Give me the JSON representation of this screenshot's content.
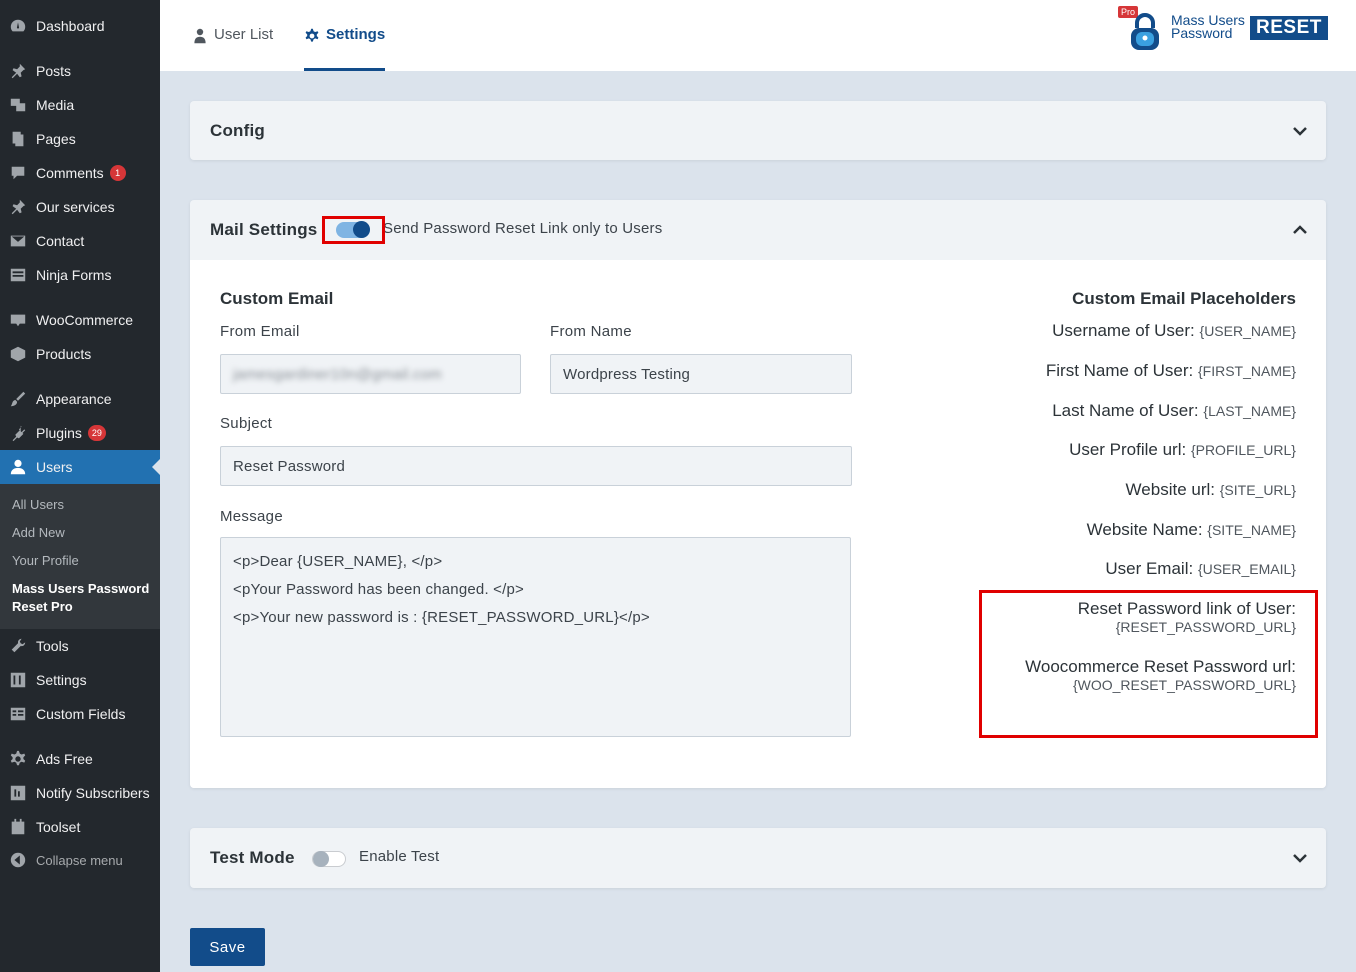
{
  "sidebar": {
    "items": [
      {
        "label": "Dashboard",
        "icon": "dashboard-icon"
      },
      {
        "label": "Posts",
        "icon": "pin-icon"
      },
      {
        "label": "Media",
        "icon": "media-icon"
      },
      {
        "label": "Pages",
        "icon": "pages-icon"
      },
      {
        "label": "Comments",
        "icon": "comment-icon",
        "badge": "1"
      },
      {
        "label": "Our services",
        "icon": "pin-icon"
      },
      {
        "label": "Contact",
        "icon": "mail-icon"
      },
      {
        "label": "Ninja Forms",
        "icon": "forms-icon"
      },
      {
        "label": "WooCommerce",
        "icon": "woo-icon"
      },
      {
        "label": "Products",
        "icon": "box-icon"
      },
      {
        "label": "Appearance",
        "icon": "brush-icon"
      },
      {
        "label": "Plugins",
        "icon": "plugin-icon",
        "badge": "29"
      },
      {
        "label": "Users",
        "icon": "user-icon"
      },
      {
        "label": "Tools",
        "icon": "wrench-icon"
      },
      {
        "label": "Settings",
        "icon": "sliders-icon"
      },
      {
        "label": "Custom Fields",
        "icon": "table-icon"
      },
      {
        "label": "Ads Free",
        "icon": "gear-icon"
      },
      {
        "label": "Notify Subscribers",
        "icon": "notify-icon"
      },
      {
        "label": "Toolset",
        "icon": "toolset-icon"
      },
      {
        "label": "Collapse menu",
        "icon": "collapse-icon"
      }
    ],
    "submenu": [
      "All Users",
      "Add New",
      "Your Profile",
      "Mass Users Password Reset Pro"
    ]
  },
  "tabs": {
    "user_list": "User List",
    "settings": "Settings"
  },
  "brand": {
    "pro": "Pro",
    "line1": "Mass Users",
    "line2": "Password",
    "reset": "RESET"
  },
  "config": {
    "title": "Config"
  },
  "mail": {
    "title": "Mail Settings",
    "toggle_label": "Send Password Reset Link only to Users",
    "toggle_on": true,
    "custom_email_title": "Custom Email",
    "from_email_label": "From Email",
    "from_email_value": "jamesgardiner10n@gmail.com",
    "from_name_label": "From Name",
    "from_name_value": "Wordpress Testing",
    "subject_label": "Subject",
    "subject_value": "Reset Password",
    "message_label": "Message",
    "message_lines": [
      "<p>Dear {USER_NAME}, </p>",
      "<pYour Password has been changed. </p>",
      "<p>Your new password is : {RESET_PASSWORD_URL}</p>"
    ],
    "placeholders_title": "Custom Email Placeholders",
    "placeholders": [
      {
        "label": "Username of User:",
        "code": "{USER_NAME}"
      },
      {
        "label": "First Name of User:",
        "code": "{FIRST_NAME}"
      },
      {
        "label": "Last Name of User:",
        "code": "{LAST_NAME}"
      },
      {
        "label": "User Profile url:",
        "code": "{PROFILE_URL}"
      },
      {
        "label": "Website url:",
        "code": "{SITE_URL}"
      },
      {
        "label": "Website Name:",
        "code": "{SITE_NAME}"
      },
      {
        "label": "User Email:",
        "code": "{USER_EMAIL}"
      },
      {
        "label": "Reset Password link of User:",
        "code": "{RESET_PASSWORD_URL}"
      },
      {
        "label": "Woocommerce Reset Password url:",
        "code": "{WOO_RESET_PASSWORD_URL}"
      }
    ]
  },
  "test_mode": {
    "title": "Test Mode",
    "toggle_label": "Enable Test",
    "toggle_on": false
  },
  "save_label": "Save",
  "colors": {
    "sidebar_bg": "#23282d",
    "accent": "#124c8a",
    "active_menu": "#2271b1",
    "highlight": "#e00000",
    "page_bg": "#dbe3ec"
  }
}
